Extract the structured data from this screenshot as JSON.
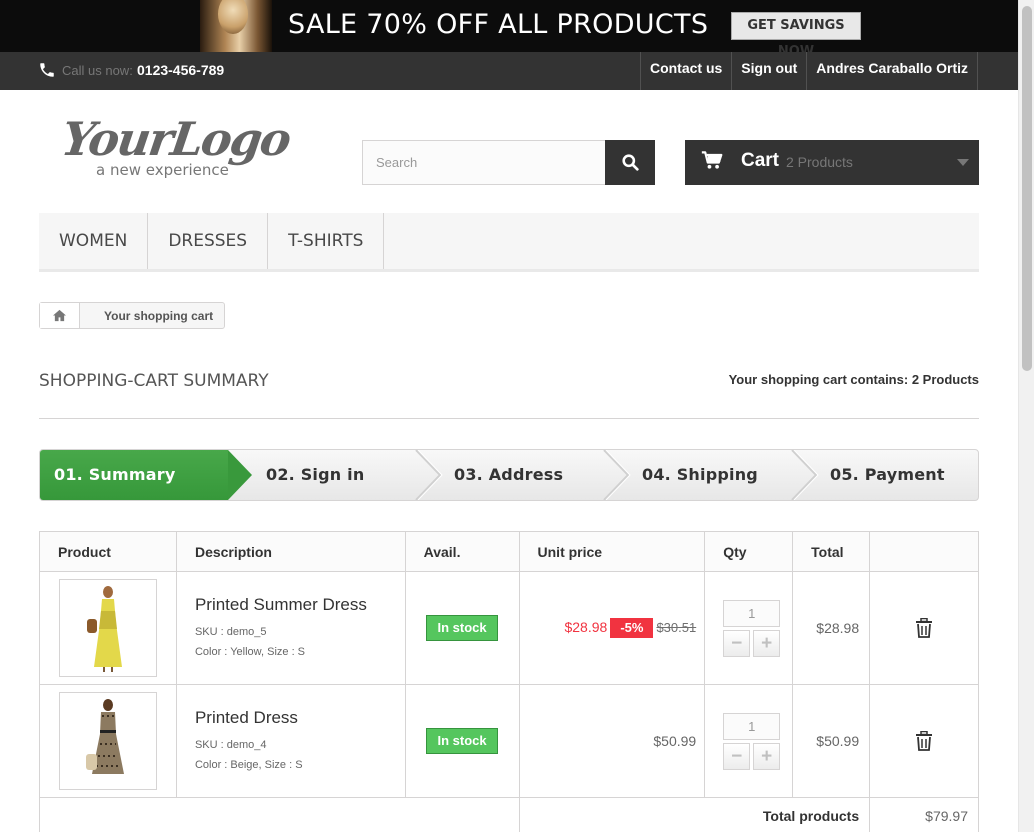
{
  "banner": {
    "text": "SALE 70% OFF ALL PRODUCTS",
    "button": "GET SAVINGS NOW"
  },
  "topnav": {
    "call_label": "Call us now:",
    "phone": "0123-456-789",
    "links": [
      "Contact us",
      "Sign out",
      "Andres Caraballo Ortiz"
    ]
  },
  "logo": {
    "word": "YourLogo",
    "tagline": "a new experience"
  },
  "search": {
    "placeholder": "Search"
  },
  "cart": {
    "label": "Cart",
    "count": "2 Products"
  },
  "menu": [
    "WOMEN",
    "DRESSES",
    "T-SHIRTS"
  ],
  "breadcrumb": {
    "current": "Your shopping cart"
  },
  "page": {
    "heading": "SHOPPING-CART SUMMARY",
    "contains_label": "Your shopping cart contains:",
    "contains_count": "2 Products"
  },
  "steps": [
    "01. Summary",
    "02. Sign in",
    "03. Address",
    "04. Shipping",
    "05. Payment"
  ],
  "table": {
    "headers": [
      "Product",
      "Description",
      "Avail.",
      "Unit price",
      "Qty",
      "Total",
      ""
    ],
    "rows": [
      {
        "name": "Printed Summer Dress",
        "sku": "SKU : demo_5",
        "color": "Color : Yellow, Size : S",
        "stock": "In stock",
        "price": "$28.98",
        "discount": "-5%",
        "old_price": "$30.51",
        "qty": "1",
        "total": "$28.98"
      },
      {
        "name": "Printed Dress",
        "sku": "SKU : demo_4",
        "color": "Color : Beige, Size : S",
        "stock": "In stock",
        "price": "$50.99",
        "qty": "1",
        "total": "$50.99"
      }
    ],
    "footer": {
      "label": "Total products",
      "value": "$79.97"
    }
  },
  "colors": {
    "accent_green": "#45a548",
    "sale_red": "#f13340",
    "dark": "#333333"
  }
}
